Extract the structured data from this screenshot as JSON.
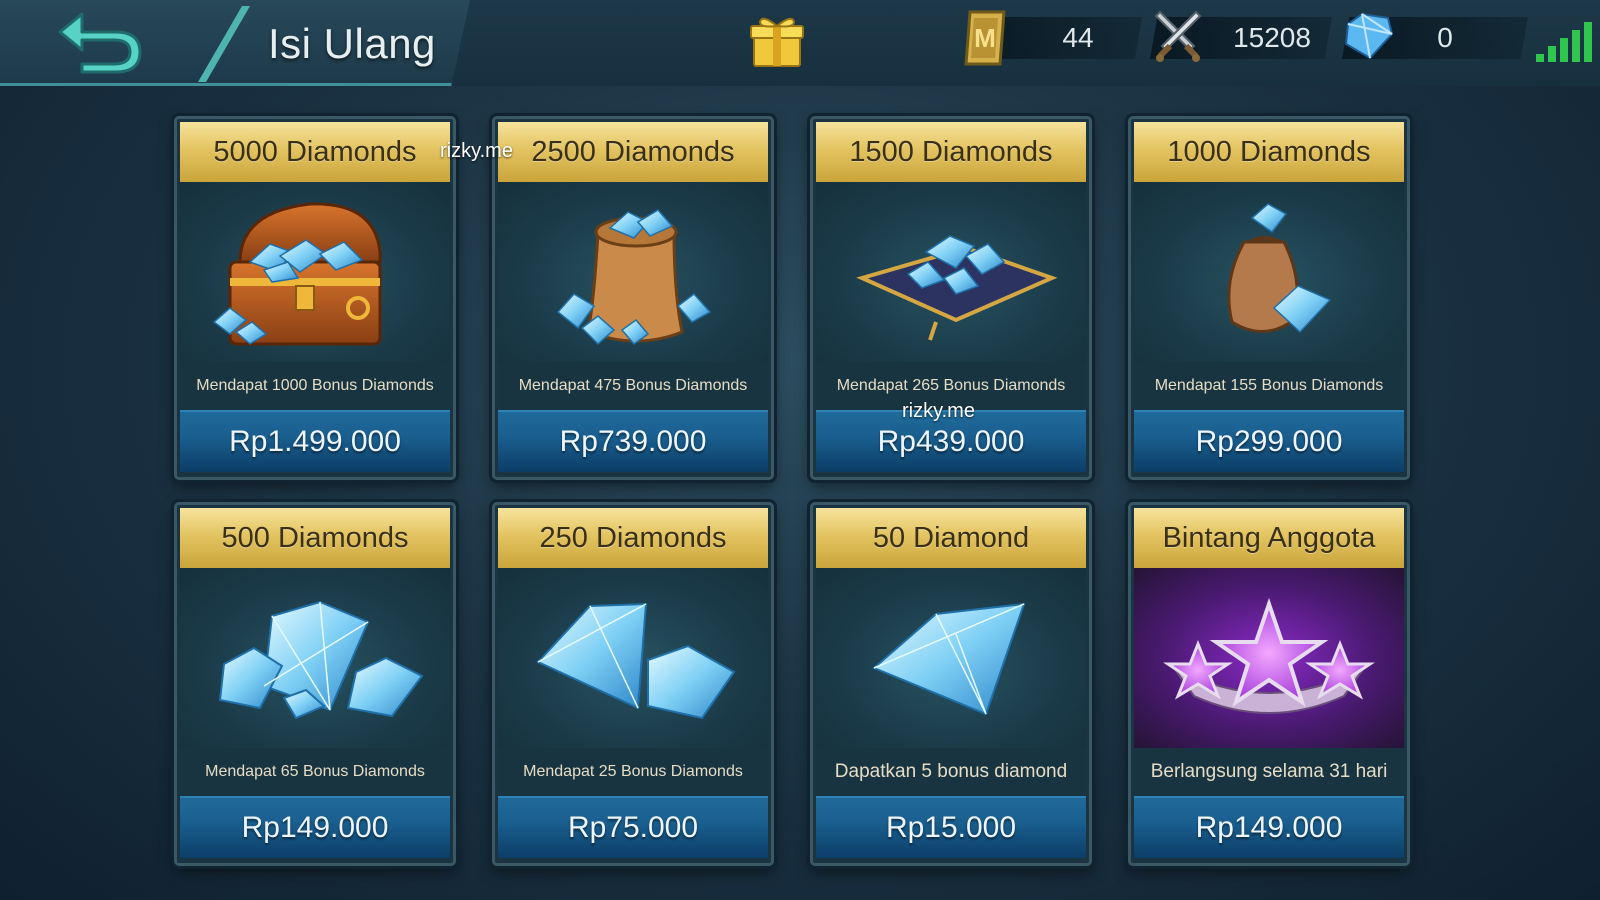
{
  "header": {
    "title": "Isi Ulang",
    "back_icon": "back-arrow-icon",
    "gift_icon": "gift-box-icon"
  },
  "currencies": [
    {
      "name": "medal",
      "icon": "m-medal-icon",
      "value": "44"
    },
    {
      "name": "battle-points",
      "icon": "crossed-swords-icon",
      "value": "15208"
    },
    {
      "name": "diamonds",
      "icon": "diamond-icon",
      "value": "0"
    }
  ],
  "signal_icon": "signal-strength-icon",
  "products": [
    {
      "title": "5000 Diamonds",
      "desc": "Mendapat 1000 Bonus Diamonds",
      "price": "Rp1.499.000",
      "art": "treasure-chest-icon"
    },
    {
      "title": "2500 Diamonds",
      "desc": "Mendapat 475 Bonus Diamonds",
      "price": "Rp739.000",
      "art": "diamond-sack-icon"
    },
    {
      "title": "1500 Diamonds",
      "desc": "Mendapat 265 Bonus Diamonds",
      "price": "Rp439.000",
      "art": "diamond-cushion-icon"
    },
    {
      "title": "1000 Diamonds",
      "desc": "Mendapat 155 Bonus Diamonds",
      "price": "Rp299.000",
      "art": "small-pouch-icon"
    },
    {
      "title": "500 Diamonds",
      "desc": "Mendapat 65 Bonus Diamonds",
      "price": "Rp149.000",
      "art": "diamond-cluster-icon"
    },
    {
      "title": "250 Diamonds",
      "desc": "Mendapat 25 Bonus Diamonds",
      "price": "Rp75.000",
      "art": "two-diamonds-icon"
    },
    {
      "title": "50 Diamond",
      "desc": "Dapatkan 5 bonus diamond",
      "price": "Rp15.000",
      "art": "single-diamond-icon"
    },
    {
      "title": "Bintang Anggota",
      "desc": "Berlangsung selama 31 hari",
      "price": "Rp149.000",
      "art": "starlight-stars-icon"
    }
  ],
  "watermarks": [
    "rizky.me",
    "rizky.me"
  ],
  "colors": {
    "title_gold": "#e3c461",
    "price_blue": "#1a5f8f",
    "signal_green": "#2fc54e",
    "starlight_purple": "#8a2ac7"
  }
}
